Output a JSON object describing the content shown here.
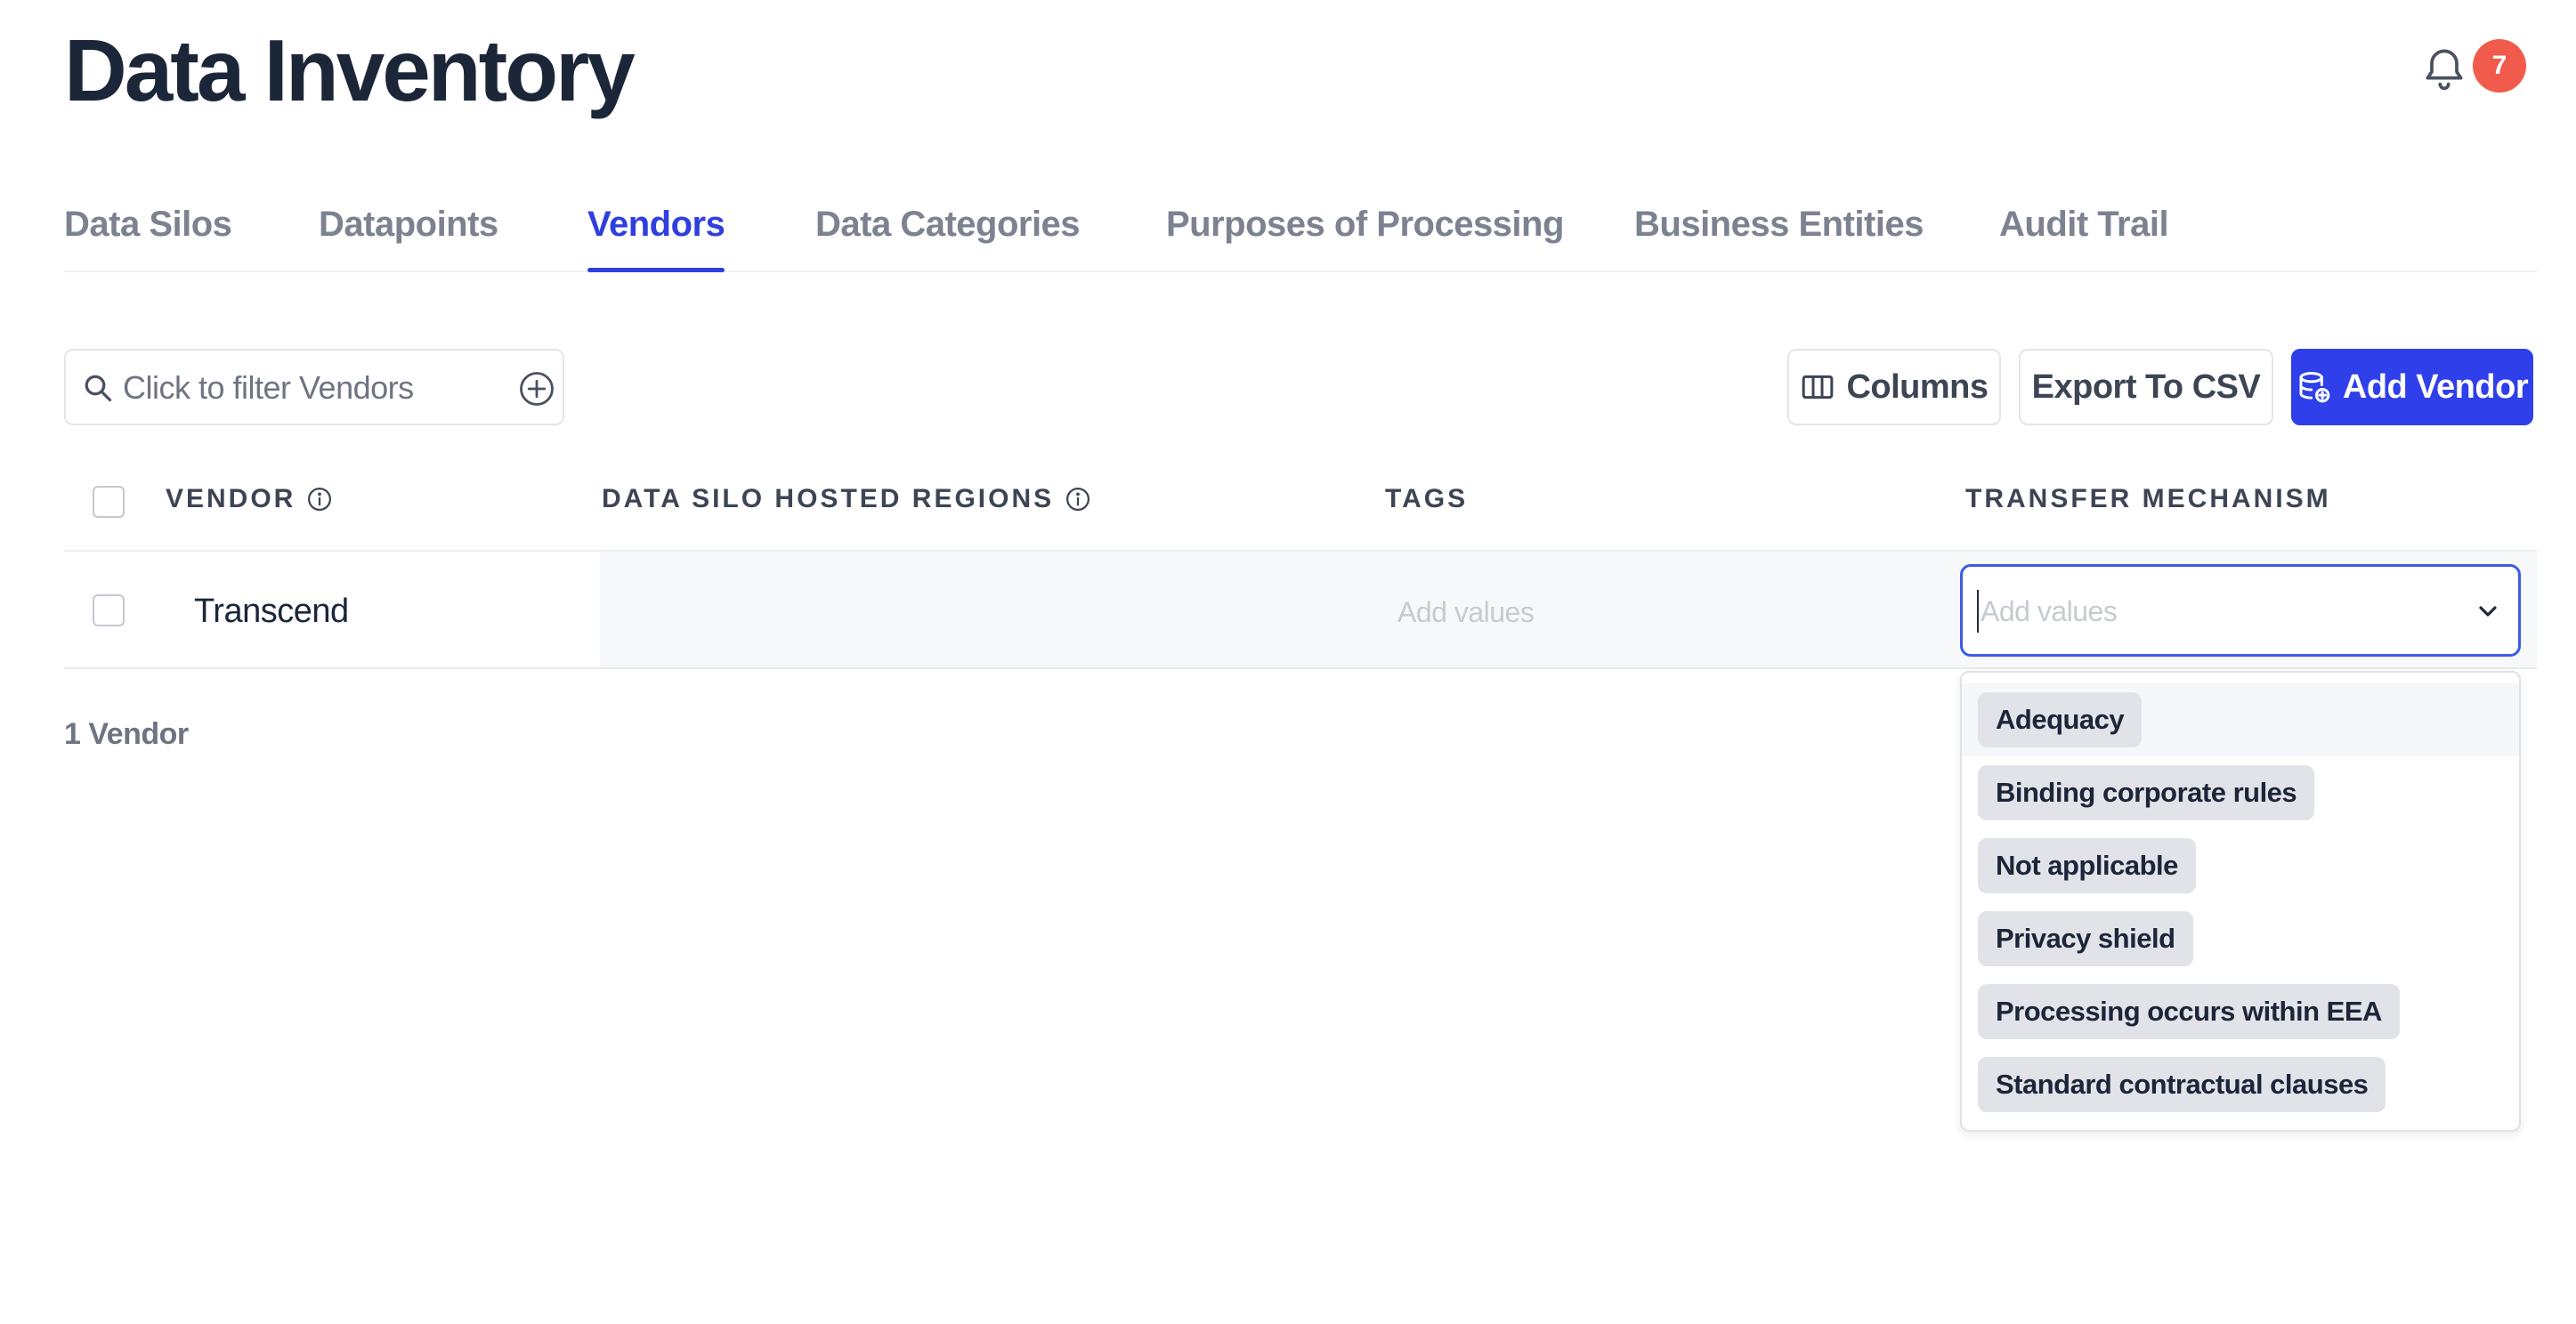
{
  "page": {
    "title": "Data Inventory"
  },
  "notifications": {
    "count": "7"
  },
  "tabs": [
    {
      "label": "Data Silos",
      "active": false
    },
    {
      "label": "Datapoints",
      "active": false
    },
    {
      "label": "Vendors",
      "active": true
    },
    {
      "label": "Data Categories",
      "active": false
    },
    {
      "label": "Purposes of Processing",
      "active": false
    },
    {
      "label": "Business Entities",
      "active": false
    },
    {
      "label": "Audit Trail",
      "active": false
    }
  ],
  "filter": {
    "placeholder": "Click to filter Vendors"
  },
  "toolbar": {
    "columns_label": "Columns",
    "export_label": "Export To CSV",
    "add_label": "Add Vendor"
  },
  "table": {
    "headers": [
      "VENDOR",
      "DATA SILO HOSTED REGIONS",
      "TAGS",
      "TRANSFER MECHANISM"
    ],
    "rows": [
      {
        "vendor": "Transcend",
        "tags_placeholder": "Add values",
        "transfer_placeholder": "Add values"
      }
    ],
    "count_label": "1 Vendor"
  },
  "transfer_dropdown": {
    "options": [
      "Adequacy",
      "Binding corporate rules",
      "Not applicable",
      "Privacy shield",
      "Processing occurs within EEA",
      "Standard contractual clauses"
    ],
    "highlighted_index": 0
  },
  "colors": {
    "accent": "#2f3fde",
    "button_primary": "#2f3fea",
    "badge": "#f15b4b",
    "focus_border": "#3b5ce6"
  },
  "icons": {
    "notifications": "bell-icon",
    "search": "search-icon",
    "add_filter": "plus-circle-icon",
    "columns": "columns-icon",
    "add_vendor": "database-plus-icon",
    "info": "info-icon",
    "dropdown": "chevron-down-icon"
  }
}
